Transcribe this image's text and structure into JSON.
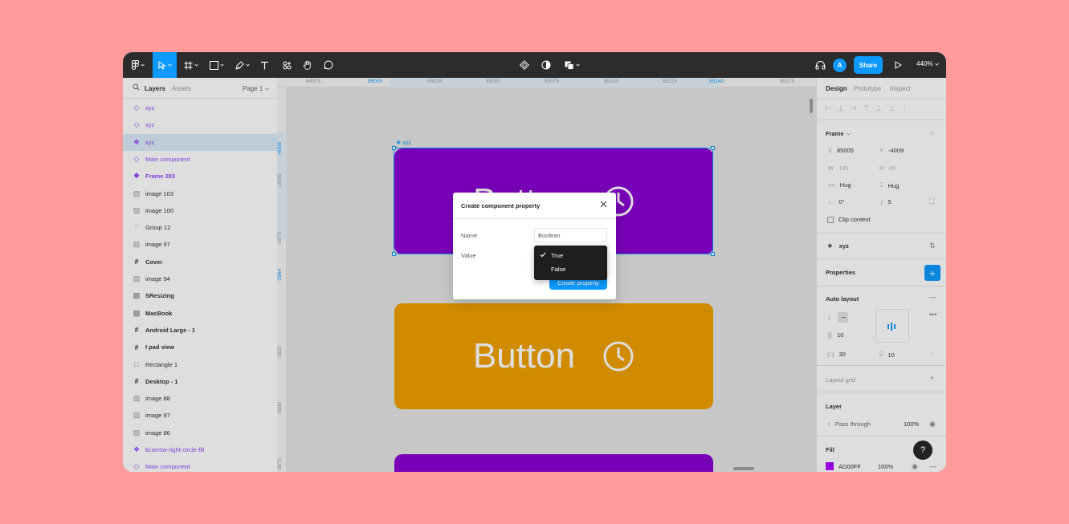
{
  "toolbar": {
    "avatar_initial": "A",
    "share_label": "Share",
    "zoom_label": "440%"
  },
  "left_panel": {
    "tab_layers": "Layers",
    "tab_assets": "Assets",
    "page_selector": "Page 1",
    "layers": [
      {
        "label": "xyz",
        "icon": "component-instance-icon"
      },
      {
        "label": "xyz",
        "icon": "component-instance-icon"
      },
      {
        "label": "xyz",
        "icon": "component-main-icon"
      },
      {
        "label": "Main component",
        "icon": "component-instance-icon"
      },
      {
        "label": "Frame 283",
        "icon": "component-main-icon"
      },
      {
        "label": "image 103",
        "icon": "image-icon"
      },
      {
        "label": "image 100",
        "icon": "image-icon"
      },
      {
        "label": "Group 12",
        "icon": "group-icon"
      },
      {
        "label": "image 97",
        "icon": "image-icon"
      },
      {
        "label": "Cover",
        "icon": "frame-icon"
      },
      {
        "label": "image 94",
        "icon": "image-icon"
      },
      {
        "label": "SResizing",
        "icon": "image-icon"
      },
      {
        "label": "MacBook",
        "icon": "image-icon"
      },
      {
        "label": "Android Large - 1",
        "icon": "frame-icon"
      },
      {
        "label": "I pad view",
        "icon": "frame-icon"
      },
      {
        "label": "Rectangle 1",
        "icon": "rectangle-icon"
      },
      {
        "label": "Desktop - 1",
        "icon": "frame-icon"
      },
      {
        "label": "image 88",
        "icon": "image-icon"
      },
      {
        "label": "image 87",
        "icon": "image-icon"
      },
      {
        "label": "image 86",
        "icon": "image-icon"
      },
      {
        "label": "bi:arrow-right-circle-fill",
        "icon": "component-main-icon"
      },
      {
        "label": "Main component",
        "icon": "component-instance-icon"
      }
    ]
  },
  "rulers": {
    "top": [
      "84975",
      "85005",
      "85025",
      "85050",
      "85075",
      "85100",
      "85125",
      "85140",
      "85175"
    ],
    "left": [
      "-4009",
      "-3925",
      "-3975",
      "-3964",
      "-3925",
      "-3900",
      "-3875"
    ]
  },
  "canvas": {
    "selection_label": "xyz",
    "card_text": "Button",
    "purple": "#8a00d4",
    "orange": "#f0a000"
  },
  "dialog": {
    "title": "Create component property",
    "name_label": "Name",
    "name_value": "Boolean",
    "value_label": "Value",
    "options": [
      "True",
      "False"
    ],
    "selected_option": "True",
    "create_label": "Create property"
  },
  "right_panel": {
    "tab_design": "Design",
    "tab_prototype": "Prototype",
    "tab_inspect": "Inspect",
    "frame_title": "Frame",
    "x_label": "X",
    "x_value": "85005",
    "y_label": "Y",
    "y_value": "-4009",
    "w_label": "W",
    "w_value": "135",
    "h_label": "H",
    "h_value": "45",
    "w_mode": "Hug",
    "h_mode": "Hug",
    "rotation": "0°",
    "radius": "5",
    "clip_content": "Clip content",
    "component_name": "xyz",
    "properties_title": "Properties",
    "auto_layout_title": "Auto layout",
    "spacing": "10",
    "padding_h": "30",
    "padding_v": "10",
    "layout_grid_title": "Layout grid",
    "layer_title": "Layer",
    "blend_mode": "Pass through",
    "layer_opacity": "100%",
    "fill_title": "Fill",
    "fill_hex": "AD00FF",
    "fill_opacity": "100%",
    "fill_color": "#ad00ff"
  }
}
